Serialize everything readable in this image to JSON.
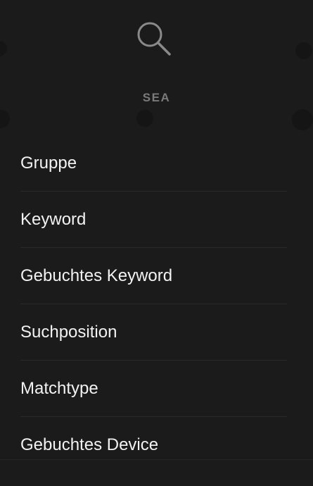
{
  "header": {
    "icon": "search-icon",
    "section_label": "SEA"
  },
  "menu": {
    "items": [
      {
        "label": "Gruppe"
      },
      {
        "label": "Keyword"
      },
      {
        "label": "Gebuchtes Keyword"
      },
      {
        "label": "Suchposition"
      },
      {
        "label": "Matchtype"
      },
      {
        "label": "Gebuchtes Device"
      }
    ]
  },
  "colors": {
    "background": "#1b1b1b",
    "text": "#f2f2f2",
    "muted": "#7a7a7a",
    "icon": "#8a8a8a",
    "divider": "#2a2a2a"
  }
}
